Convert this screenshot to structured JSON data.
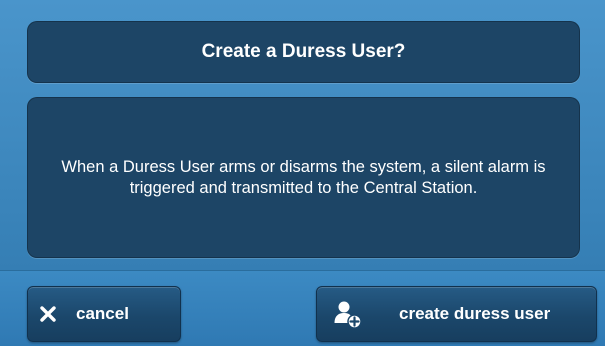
{
  "dialog": {
    "title": "Create a Duress User?",
    "message": "When a Duress User arms or disarms the system, a silent alarm is triggered and transmitted to the Central Station."
  },
  "buttons": {
    "cancel": {
      "label": "cancel",
      "icon": "close-icon"
    },
    "create": {
      "label": "create duress user",
      "icon": "add-user-icon"
    }
  },
  "colors": {
    "background": "#3f88bf",
    "panel": "#1d4566",
    "button": "#1f4c72",
    "text": "#ffffff"
  }
}
